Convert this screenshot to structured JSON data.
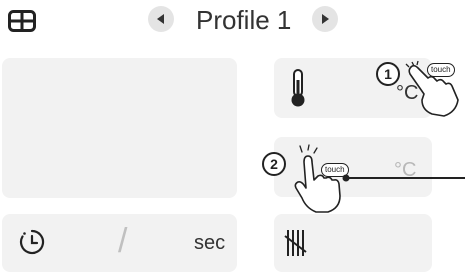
{
  "header": {
    "profile_title": "Profile 1",
    "menu_icon": "grid-menu-icon",
    "prev_icon": "triangle-left-icon",
    "next_icon": "triangle-right-icon"
  },
  "temperature_tile": {
    "icon": "thermometer-icon",
    "unit": "°C"
  },
  "tile_2": {
    "unit": "°C"
  },
  "timer_tile": {
    "icon": "clock-icon",
    "separator": "/",
    "unit": "sec"
  },
  "count_tile": {
    "icon": "tally-icon"
  },
  "callouts": [
    {
      "number": "1",
      "badge": "touch",
      "icon": "hand-pointer-icon"
    },
    {
      "number": "2",
      "badge": "touch",
      "icon": "hand-pointer-icon"
    }
  ],
  "colors": {
    "tile_background": "#f2f2f2",
    "unit_gray": "#b8b8b8",
    "text_dark": "#333333"
  }
}
